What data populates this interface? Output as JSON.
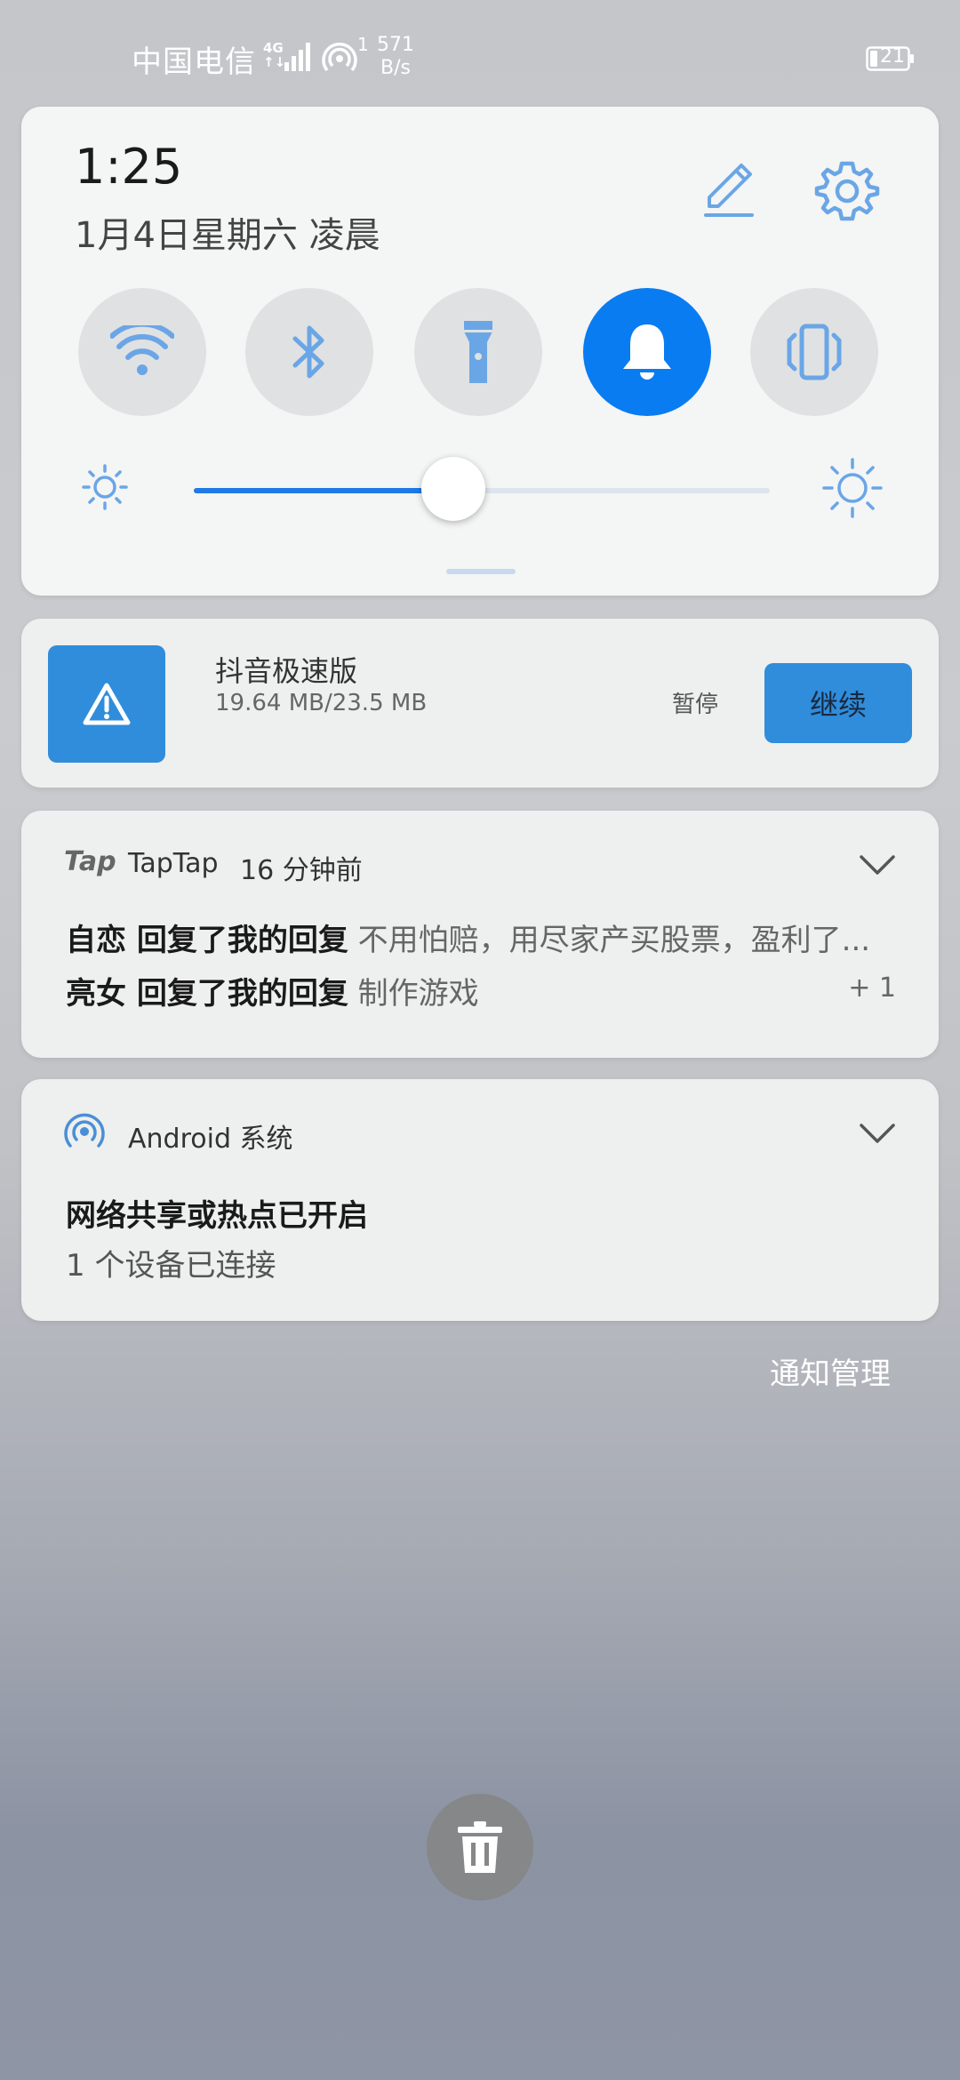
{
  "status_bar": {
    "carrier": "中国电信",
    "network_badge_top": "4G",
    "network_badge_bottom": "↑↓",
    "hotspot_count": "1",
    "speed_value": "571",
    "speed_unit": "B/s",
    "battery": "21"
  },
  "quick_settings": {
    "time": "1:25",
    "date": "1月4日星期六 凌晨",
    "toggles": [
      {
        "id": "wifi",
        "icon": "wifi-icon",
        "active": false
      },
      {
        "id": "bluetooth",
        "icon": "bluetooth-icon",
        "active": false
      },
      {
        "id": "flashlight",
        "icon": "flashlight-icon",
        "active": false
      },
      {
        "id": "sound",
        "icon": "bell-icon",
        "active": true
      },
      {
        "id": "vibrate",
        "icon": "vibrate-icon",
        "active": false
      }
    ],
    "brightness_level": 0.45
  },
  "download": {
    "title": "抖音极速版",
    "size": "19.64 MB/23.5 MB",
    "pause_label": "暂停",
    "resume_label": "继续"
  },
  "taptap": {
    "logo": "Tap",
    "app_name": "TapTap",
    "time": "16 分钟前",
    "messages": [
      {
        "sender": "自恋 回复了我的回复",
        "text": "不用怕赔，用尽家产买股票，盈利了..."
      },
      {
        "sender": "亮女 回复了我的回复",
        "text": "制作游戏"
      }
    ],
    "more_count": "+ 1"
  },
  "system": {
    "app_name": "Android 系统",
    "title": "网络共享或热点已开启",
    "subtitle": "1 个设备已连接"
  },
  "footer": {
    "manage_label": "通知管理"
  },
  "colors": {
    "accent": "#0a7cf2",
    "download_blue": "#2f8ddb",
    "icon_blue": "#6aa6e6"
  }
}
